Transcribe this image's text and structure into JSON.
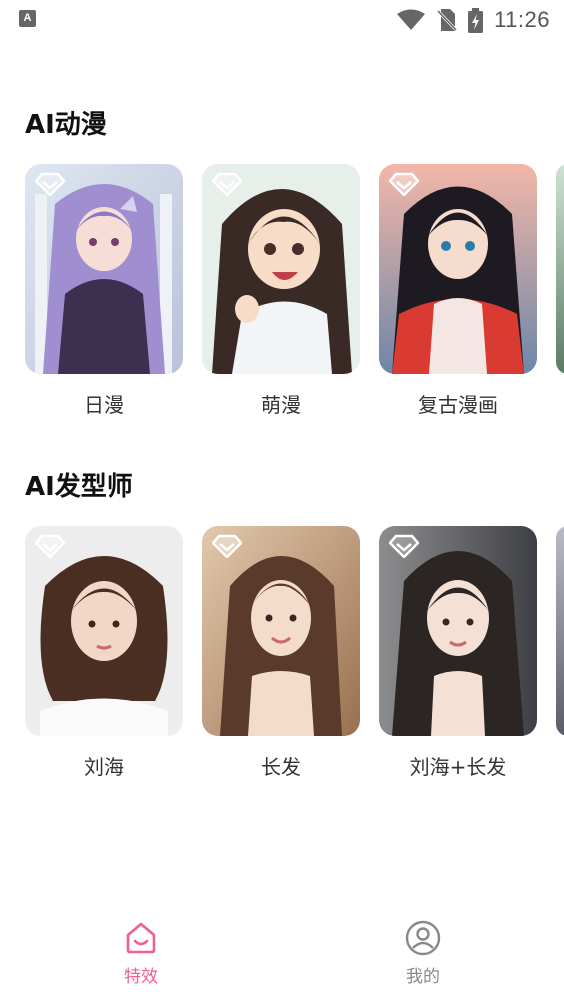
{
  "status_bar": {
    "app_icon_letter": "A",
    "time": "11:26",
    "icons": [
      "wifi-icon",
      "no-sim-icon",
      "battery-charging-icon"
    ]
  },
  "sections": [
    {
      "title": "AI动漫",
      "cards": [
        {
          "label": "日漫",
          "vip": true
        },
        {
          "label": "萌漫",
          "vip": true
        },
        {
          "label": "复古漫画",
          "vip": true
        }
      ]
    },
    {
      "title": "AI发型师",
      "cards": [
        {
          "label": "刘海",
          "vip": true
        },
        {
          "label": "长发",
          "vip": true
        },
        {
          "label": "刘海+长发",
          "vip": true
        }
      ]
    }
  ],
  "bottom_nav": {
    "items": [
      {
        "label": "特效",
        "icon": "home-smile-icon",
        "active": true
      },
      {
        "label": "我的",
        "icon": "profile-icon",
        "active": false
      }
    ]
  },
  "colors": {
    "accent": "#f0608a",
    "inactive": "#888888"
  }
}
